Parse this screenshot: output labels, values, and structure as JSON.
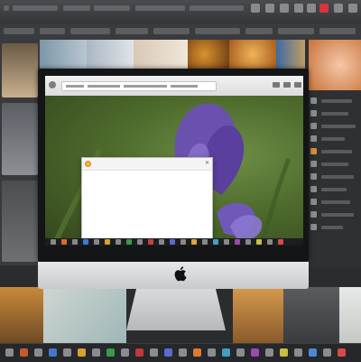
{
  "browser": {
    "url": "",
    "tab_title": ""
  },
  "dialog": {
    "title": "",
    "lines": [
      "",
      "",
      "",
      "",
      "",
      "",
      "",
      "",
      "",
      "",
      "",
      "",
      ""
    ],
    "primary_button": "",
    "secondary_button": ""
  },
  "colors": {
    "accent_blue": "#1e7fd8",
    "close_red": "#d8343c",
    "flower_purple": "#6a4fb0",
    "foliage_green": "#4e6b2c"
  },
  "icons": [
    "apple-logo",
    "firefox-logo",
    "close-icon",
    "back-icon",
    "forward-icon",
    "minimize-icon",
    "maximize-icon"
  ]
}
